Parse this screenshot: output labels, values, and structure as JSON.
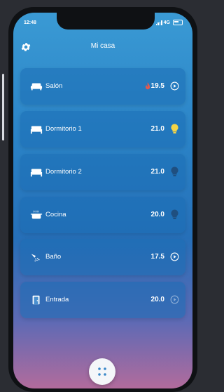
{
  "status_bar": {
    "time": "12:48",
    "network": "4G"
  },
  "header": {
    "title": "Mi casa",
    "settings_icon": "gear-icon"
  },
  "rooms": [
    {
      "name": "Salón",
      "temperature": "19.5",
      "icon": "sofa-icon",
      "indicators": [
        "flame-icon",
        "play-circle-icon"
      ]
    },
    {
      "name": "Dormitorio 1",
      "temperature": "21.0",
      "icon": "bed-icon",
      "indicators": [
        "bulb-icon"
      ],
      "bulb_color": "#f5d547"
    },
    {
      "name": "Dormitorio 2",
      "temperature": "21.0",
      "icon": "bed-icon",
      "indicators": [
        "bulb-icon"
      ],
      "bulb_color": "#1f4f80"
    },
    {
      "name": "Cocina",
      "temperature": "20.0",
      "icon": "pot-icon",
      "indicators": [
        "bulb-icon"
      ],
      "bulb_color": "#1f4f80"
    },
    {
      "name": "Baño",
      "temperature": "17.5",
      "icon": "shower-icon",
      "indicators": [
        "play-circle-icon"
      ]
    },
    {
      "name": "Entrada",
      "temperature": "20.0",
      "icon": "door-icon",
      "indicators": [
        "play-circle-icon"
      ],
      "indicator_muted": true
    }
  ],
  "fab": {
    "icon": "grid-dots-icon"
  }
}
